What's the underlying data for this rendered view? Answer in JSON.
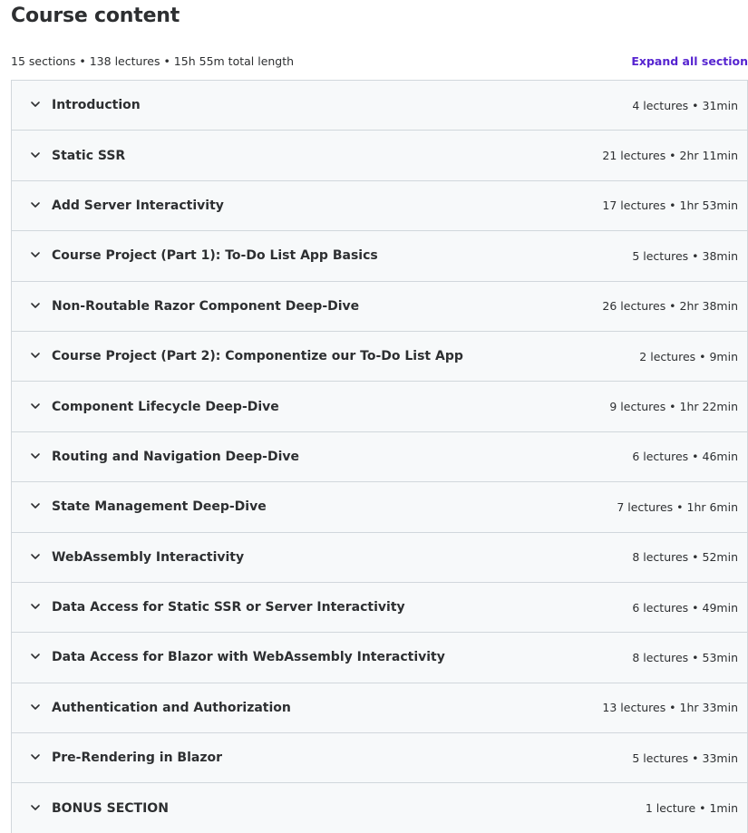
{
  "header": {
    "title": "Course content",
    "summary": "15 sections • 138 lectures • 15h 55m total length",
    "expand_label": "Expand all section"
  },
  "colors": {
    "accent": "#5624d0",
    "section_bg": "#f7f9fa",
    "border": "#d1d7dc",
    "text": "#2d2f31"
  },
  "icons": {
    "section_toggle": "chevron-down-icon"
  },
  "sections": [
    {
      "title": "Introduction",
      "meta": "4 lectures • 31min"
    },
    {
      "title": "Static SSR",
      "meta": "21 lectures • 2hr 11min"
    },
    {
      "title": "Add Server Interactivity",
      "meta": "17 lectures • 1hr 53min"
    },
    {
      "title": "Course Project (Part 1): To-Do List App Basics",
      "meta": "5 lectures • 38min"
    },
    {
      "title": "Non-Routable Razor Component Deep-Dive",
      "meta": "26 lectures • 2hr 38min"
    },
    {
      "title": "Course Project (Part 2): Componentize our To-Do List App",
      "meta": "2 lectures • 9min"
    },
    {
      "title": "Component Lifecycle Deep-Dive",
      "meta": "9 lectures • 1hr 22min"
    },
    {
      "title": "Routing and Navigation Deep-Dive",
      "meta": "6 lectures • 46min"
    },
    {
      "title": "State Management Deep-Dive",
      "meta": "7 lectures • 1hr 6min"
    },
    {
      "title": "WebAssembly Interactivity",
      "meta": "8 lectures • 52min"
    },
    {
      "title": "Data Access for Static SSR or Server Interactivity",
      "meta": "6 lectures • 49min"
    },
    {
      "title": "Data Access for Blazor with WebAssembly Interactivity",
      "meta": "8 lectures • 53min"
    },
    {
      "title": "Authentication and Authorization",
      "meta": "13 lectures • 1hr 33min"
    },
    {
      "title": "Pre-Rendering in Blazor",
      "meta": "5 lectures • 33min"
    },
    {
      "title": "BONUS SECTION",
      "meta": "1 lecture • 1min"
    }
  ]
}
